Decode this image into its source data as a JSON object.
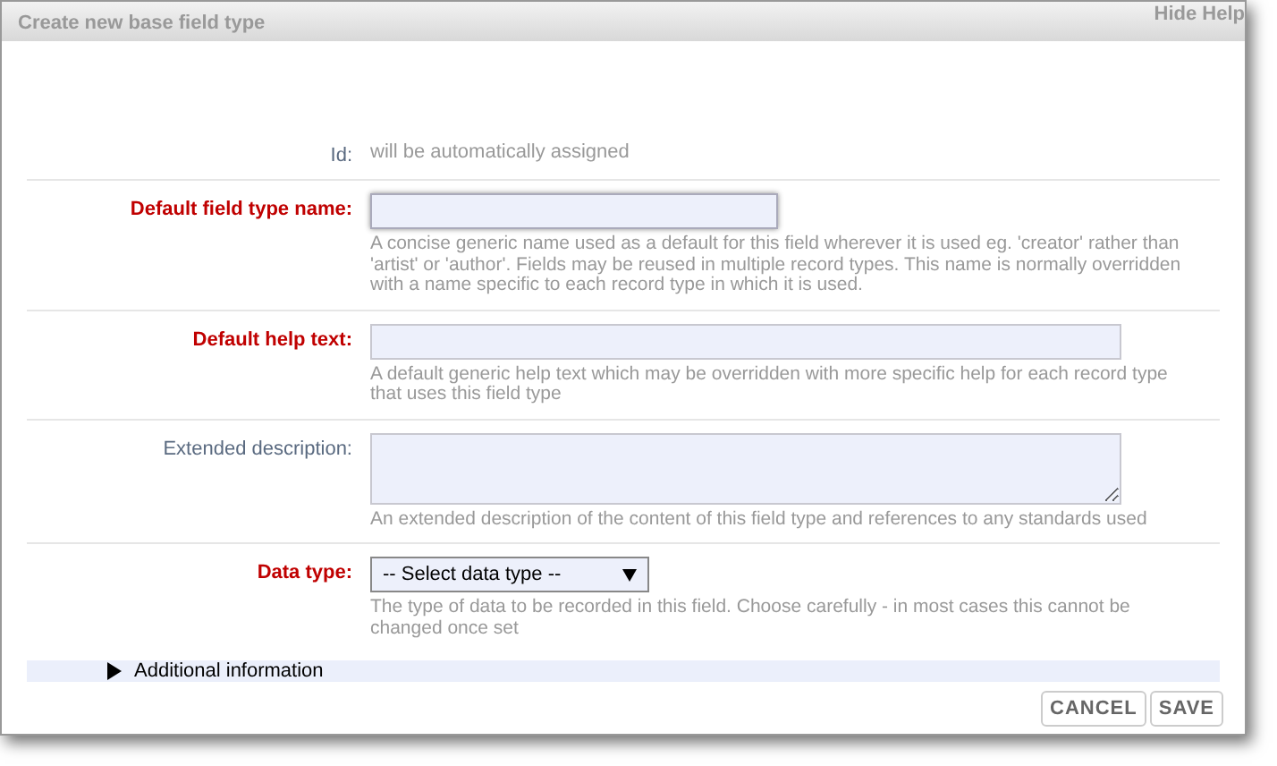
{
  "window": {
    "title": "Create new base field type",
    "help_link": "Hide Help"
  },
  "fields": [
    {
      "kind": "static",
      "label": "Id:",
      "required": false,
      "value": "will be automatically assigned"
    },
    {
      "kind": "text",
      "label": "Default field type name:",
      "required": true,
      "focused": true,
      "help": "A concise generic name used as a default for this field wherever it is used eg. 'creator' rather than 'artist' or 'author'. Fields may be reused in multiple record types. This name is normally overridden with a name specific to each record type in which it is used."
    },
    {
      "kind": "text_wide",
      "label": "Default help text:",
      "required": true,
      "focused": false,
      "help": "A default generic help text which may be overridden with more specific help for each record type that uses this field type"
    },
    {
      "kind": "textarea",
      "label": "Extended description:",
      "required": false,
      "help": "An extended description of the content of this field type and references to any standards used"
    },
    {
      "kind": "select",
      "label": "Data type:",
      "required": true,
      "value": "-- Select data type --",
      "help": "The type of data to be recorded in this field. Choose carefully - in most cases this cannot be changed once set"
    }
  ],
  "section": {
    "label": "Additional information",
    "expanded": false
  },
  "buttons": [
    "CANCEL",
    "SAVE"
  ]
}
